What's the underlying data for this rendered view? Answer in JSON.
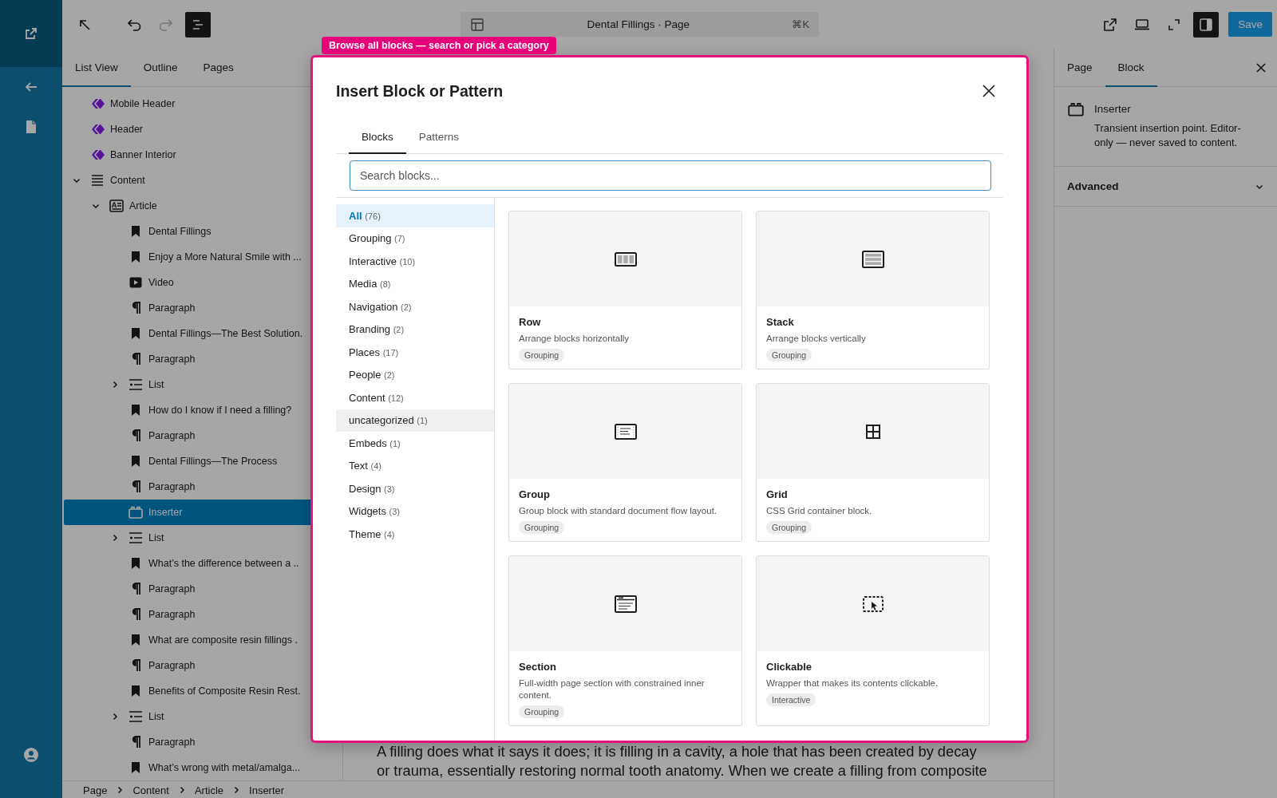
{
  "rail": {
    "items": [
      {
        "kind": "site"
      },
      {
        "kind": "back"
      },
      {
        "kind": "pages"
      }
    ],
    "account": {
      "kind": "user"
    }
  },
  "topbar": {
    "list_view_toggle": {
      "on": true
    },
    "undo": {
      "disabled": false
    },
    "redo": {
      "disabled": true
    },
    "document_title": "Dental Fillings · Page",
    "shortcut": "⌘K",
    "sidebar_toggle": {
      "on": true
    },
    "save_label": "Save"
  },
  "left_panel": {
    "tabs": [
      {
        "label": "List View",
        "selected": true
      },
      {
        "label": "Outline",
        "selected": false
      },
      {
        "label": "Pages",
        "selected": false
      }
    ],
    "tree": [
      {
        "kind": "pattern",
        "label": "Mobile Header",
        "selected": false
      },
      {
        "kind": "pattern",
        "label": "Header",
        "selected": false
      },
      {
        "kind": "pattern",
        "label": "Banner Interior",
        "selected": false
      },
      {
        "kind": "group",
        "label": "Content",
        "selected": false,
        "expanded": true,
        "children": [
          {
            "kind": "article",
            "label": "Article",
            "selected": false,
            "expanded": true,
            "children": [
              {
                "kind": "heading",
                "label": "Dental Fillings",
                "selected": false
              },
              {
                "kind": "heading",
                "label": "Enjoy a More Natural Smile with ...",
                "selected": false
              },
              {
                "kind": "video",
                "label": "Video",
                "selected": false
              },
              {
                "kind": "paragraph",
                "label": "Paragraph",
                "selected": false
              },
              {
                "kind": "heading",
                "label": "Dental Fillings—The Best Solution.",
                "selected": false
              },
              {
                "kind": "paragraph",
                "label": "Paragraph",
                "selected": false
              },
              {
                "kind": "list",
                "label": "List",
                "selected": false,
                "expanded": false
              },
              {
                "kind": "heading",
                "label": "How do I know if I need a filling?",
                "selected": false
              },
              {
                "kind": "paragraph",
                "label": "Paragraph",
                "selected": false
              },
              {
                "kind": "heading",
                "label": "Dental Fillings—The Process",
                "selected": false
              },
              {
                "kind": "paragraph",
                "label": "Paragraph",
                "selected": false
              },
              {
                "kind": "inserter",
                "label": "Inserter",
                "selected": true
              },
              {
                "kind": "list",
                "label": "List",
                "selected": false,
                "expanded": false
              },
              {
                "kind": "heading",
                "label": "What’s the difference between a ..",
                "selected": false
              },
              {
                "kind": "paragraph",
                "label": "Paragraph",
                "selected": false
              },
              {
                "kind": "paragraph",
                "label": "Paragraph",
                "selected": false
              },
              {
                "kind": "heading",
                "label": "What are composite resin fillings .",
                "selected": false
              },
              {
                "kind": "paragraph",
                "label": "Paragraph",
                "selected": false
              },
              {
                "kind": "heading",
                "label": "Benefits of Composite Resin Rest.",
                "selected": false
              },
              {
                "kind": "list",
                "label": "List",
                "selected": false,
                "expanded": false
              },
              {
                "kind": "paragraph",
                "label": "Paragraph",
                "selected": false
              },
              {
                "kind": "heading",
                "label": "What’s wrong with metal/amalga...",
                "selected": false
              }
            ]
          }
        ]
      }
    ]
  },
  "canvas": {
    "paragraph_lines": [
      "A filling does what it says it does; it is filling in a cavity, a hole that has been created by decay",
      "or trauma, essentially restoring normal tooth anatomy. When we create a filling from composite"
    ]
  },
  "breadcrumb": [
    "Page",
    "Content",
    "Article",
    "Inserter"
  ],
  "inspector": {
    "tabs": [
      {
        "label": "Page",
        "selected": false
      },
      {
        "label": "Block",
        "selected": true
      }
    ],
    "block": {
      "kind": "inserter",
      "name": "Inserter",
      "description": "Transient insertion point. Editor-only — never saved to content."
    },
    "sections": [
      {
        "label": "Advanced",
        "expanded": false
      }
    ]
  },
  "callout": "Browse all blocks — search or pick a category",
  "inserter": {
    "title": "Insert Block or Pattern",
    "tabs": [
      {
        "label": "Blocks",
        "selected": true
      },
      {
        "label": "Patterns",
        "selected": false
      }
    ],
    "search": {
      "placeholder": "Search blocks..."
    },
    "categories": [
      {
        "label": "All",
        "count": "(76)",
        "selected": true,
        "hovered": false
      },
      {
        "label": "Grouping",
        "count": "(7)",
        "selected": false,
        "hovered": false
      },
      {
        "label": "Interactive",
        "count": "(10)",
        "selected": false,
        "hovered": false
      },
      {
        "label": "Media",
        "count": "(8)",
        "selected": false,
        "hovered": false
      },
      {
        "label": "Navigation",
        "count": "(2)",
        "selected": false,
        "hovered": false
      },
      {
        "label": "Branding",
        "count": "(2)",
        "selected": false,
        "hovered": false
      },
      {
        "label": "Places",
        "count": "(17)",
        "selected": false,
        "hovered": false
      },
      {
        "label": "People",
        "count": "(2)",
        "selected": false,
        "hovered": false
      },
      {
        "label": "Content",
        "count": "(12)",
        "selected": false,
        "hovered": false
      },
      {
        "label": "uncategorized",
        "count": "(1)",
        "selected": false,
        "hovered": true
      },
      {
        "label": "Embeds",
        "count": "(1)",
        "selected": false,
        "hovered": false
      },
      {
        "label": "Text",
        "count": "(4)",
        "selected": false,
        "hovered": false
      },
      {
        "label": "Design",
        "count": "(3)",
        "selected": false,
        "hovered": false
      },
      {
        "label": "Widgets",
        "count": "(3)",
        "selected": false,
        "hovered": false
      },
      {
        "label": "Theme",
        "count": "(4)",
        "selected": false,
        "hovered": false
      }
    ],
    "blocks": [
      {
        "kind": "row",
        "name": "Row",
        "description": "Arrange blocks horizontally",
        "category": "Grouping"
      },
      {
        "kind": "stack",
        "name": "Stack",
        "description": "Arrange blocks vertically",
        "category": "Grouping"
      },
      {
        "kind": "group",
        "name": "Group",
        "description": "Group block with standard document flow layout.",
        "category": "Grouping"
      },
      {
        "kind": "grid",
        "name": "Grid",
        "description": "CSS Grid container block.",
        "category": "Grouping"
      },
      {
        "kind": "section",
        "name": "Section",
        "description": "Full-width page section with constrained inner content.",
        "category": "Grouping"
      },
      {
        "kind": "clickable",
        "name": "Clickable",
        "description": "Wrapper that makes its contents clickable.",
        "category": "Interactive"
      }
    ]
  }
}
